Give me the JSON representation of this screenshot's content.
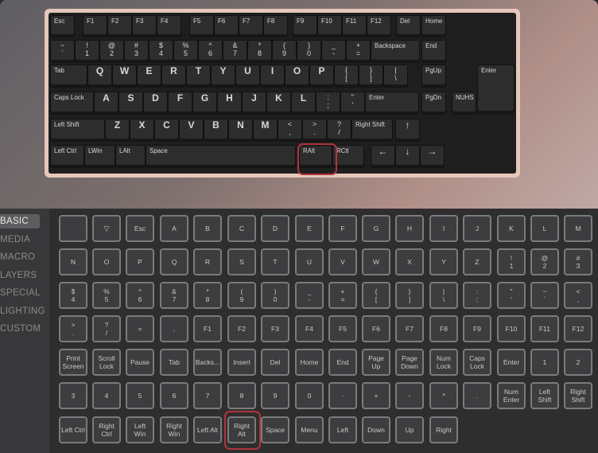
{
  "keyboard": {
    "keys": [
      [
        "Esc",
        "F1",
        "F2",
        "F3",
        "F4",
        "F5",
        "F6",
        "F7",
        "F8",
        "F9",
        "F10",
        "F11",
        "F12",
        "Del",
        "Home"
      ],
      [
        "~\n`",
        "!\n1",
        "@\n2",
        "#\n3",
        "$\n4",
        "%\n5",
        "^\n6",
        "&\n7",
        "*\n8",
        "(\n9",
        ")\n0",
        "_\n-",
        "+\n=",
        "Backspace",
        "End"
      ],
      [
        "Tab",
        "Q",
        "W",
        "E",
        "R",
        "T",
        "Y",
        "U",
        "I",
        "O",
        "P",
        "{\n[",
        "}\n]",
        "|\n\\",
        "PgUp",
        "Enter"
      ],
      [
        "Caps Lock",
        "A",
        "S",
        "D",
        "F",
        "G",
        "H",
        "J",
        "K",
        "L",
        ":\n;",
        "\"\n'",
        "Enter",
        "PgDn",
        "NUHS"
      ],
      [
        "Left Shift",
        "Z",
        "X",
        "C",
        "V",
        "B",
        "N",
        "M",
        "<\n,",
        ">\n.",
        "?\n/",
        "Right Shift",
        "↑"
      ],
      [
        "Left Ctrl",
        "LWin",
        "LAlt",
        "Space",
        "RAlt",
        "RCtl",
        "←",
        "↓",
        "→"
      ]
    ]
  },
  "sidebar": {
    "tabs": [
      "BASIC",
      "MEDIA",
      "MACRO",
      "LAYERS",
      "SPECIAL",
      "LIGHTING",
      "CUSTOM"
    ],
    "active": "BASIC"
  },
  "basic_keys": [
    [
      "",
      "▽",
      "Esc",
      "A",
      "B",
      "C",
      "D",
      "E",
      "F",
      "G",
      "H",
      "I",
      "J",
      "K",
      "L",
      "M"
    ],
    [
      "N",
      "O",
      "P",
      "Q",
      "R",
      "S",
      "T",
      "U",
      "V",
      "W",
      "X",
      "Y",
      "Z",
      "!\n1",
      "@\n2",
      "#\n3"
    ],
    [
      "$\n4",
      "%\n5",
      "^\n6",
      "&\n7",
      "*\n8",
      "(\n9",
      ")\n0",
      "_\n-",
      "+\n=",
      "{\n[",
      "}\n]",
      "|\n\\",
      ":\n;",
      "\"\n'",
      "~\n`",
      "<\n,"
    ],
    [
      ">\n.",
      "?\n/",
      "=",
      ",",
      "F1",
      "F2",
      "F3",
      "F4",
      "F5",
      "F6",
      "F7",
      "F8",
      "F9",
      "F10",
      "F11",
      "F12"
    ],
    [
      "Print\nScreen",
      "Scroll\nLock",
      "Pause",
      "Tab",
      "Backs...",
      "Insert",
      "Del",
      "Home",
      "End",
      "Page\nUp",
      "Page\nDown",
      "Num\nLock",
      "Caps\nLock",
      "Enter",
      "1",
      "2"
    ],
    [
      "3",
      "4",
      "5",
      "6",
      "7",
      "8",
      "9",
      "0",
      "·",
      "+",
      "-",
      "*",
      ".",
      "Num\nEnter",
      "Left\nShift",
      "Right\nShift"
    ],
    [
      "Left Ctrl",
      "Right\nCtrl",
      "Left\nWin",
      "Right\nWin",
      "Left Alt",
      "Right\nAlt",
      "Space",
      "Menu",
      "Left",
      "Down",
      "Up",
      "Right"
    ]
  ],
  "colors": {
    "highlight": "#b2343d",
    "keyboard_frame": "#e6c7bb"
  }
}
